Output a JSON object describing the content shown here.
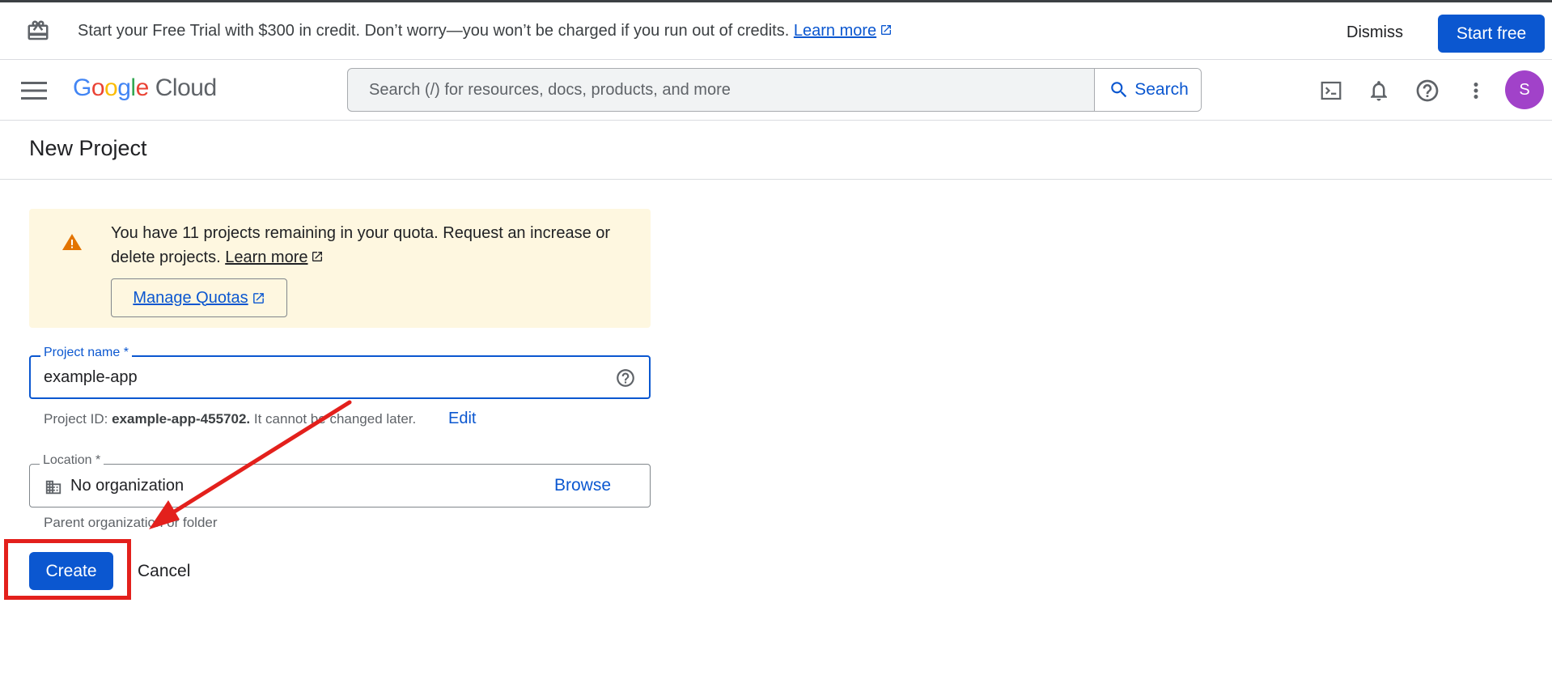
{
  "promo": {
    "message": "Start your Free Trial with $300 in credit. Don’t worry—you won’t be charged if you run out of credits.",
    "learn_more": "Learn more",
    "dismiss": "Dismiss",
    "start_free": "Start free"
  },
  "header": {
    "logo_google": [
      "G",
      "o",
      "o",
      "g",
      "l",
      "e"
    ],
    "logo_cloud": "Cloud",
    "search_placeholder": "Search (/) for resources, docs, products, and more",
    "search_button": "Search",
    "avatar_initial": "S"
  },
  "page": {
    "title": "New Project"
  },
  "notice": {
    "message": "You have 11 projects remaining in your quota. Request an increase or delete projects.",
    "learn_more": "Learn more",
    "manage_quotas": "Manage Quotas"
  },
  "form": {
    "project_name_label": "Project name *",
    "project_name_value": "example-app",
    "project_id_prefix": "Project ID:",
    "project_id_value": "example-app-455702.",
    "project_id_suffix": "It cannot be changed later.",
    "edit": "Edit",
    "location_label": "Location *",
    "location_value": "No organization",
    "browse": "Browse",
    "location_hint": "Parent organization or folder",
    "create": "Create",
    "cancel": "Cancel"
  },
  "colors": {
    "primary": "#0b57d0",
    "notice_bg": "#fef7e0",
    "warning": "#e37400",
    "annotation": "#e3201c",
    "avatar": "#a142c9"
  }
}
